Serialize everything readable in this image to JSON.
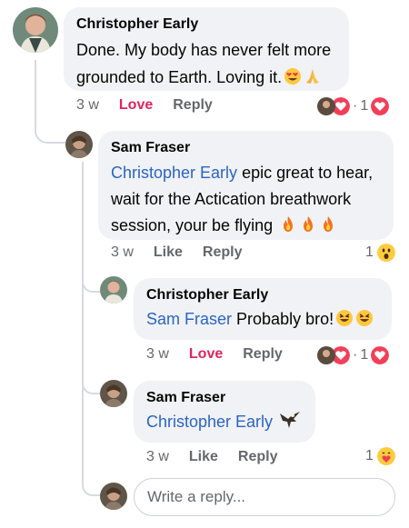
{
  "colors": {
    "accent_love": "#e0245e",
    "mention": "#2b64c5",
    "bubble": "#f0f2f5"
  },
  "comments": [
    {
      "author": "Christopher Early",
      "text": "Done. My body has never felt more grounded to Earth. Loving it.",
      "time": "3 w",
      "love": "Love",
      "reply": "Reply",
      "reaction_count": "1",
      "secondary_count": "1",
      "emojis": [
        "heart-eyes-emoji",
        "praying-hands-emoji"
      ]
    },
    {
      "author": "Sam Fraser",
      "mention": "Christopher Early",
      "text_a": " epic great to hear,",
      "text_b": "wait for the Actication breathwork",
      "text_c": "session, your be flying ",
      "time": "3 w",
      "like": "Like",
      "reply": "Reply",
      "reaction_count": "1",
      "emojis": [
        "fire-emoji",
        "fire-emoji",
        "fire-emoji"
      ]
    },
    {
      "author": "Christopher Early",
      "mention": "Sam Fraser",
      "text": " Probably bro!",
      "time": "3 w",
      "love": "Love",
      "reply": "Reply",
      "reaction_count": "1",
      "secondary_count": "1",
      "emojis": [
        "laughing-emoji",
        "laughing-emoji"
      ]
    },
    {
      "author": "Sam Fraser",
      "mention": "Christopher Early",
      "time": "3 w",
      "like": "Like",
      "reply": "Reply",
      "reaction_count": "1",
      "emojis": [
        "eagle-emoji"
      ]
    }
  ],
  "reply_box": {
    "placeholder": "Write a reply..."
  },
  "separator": "·"
}
